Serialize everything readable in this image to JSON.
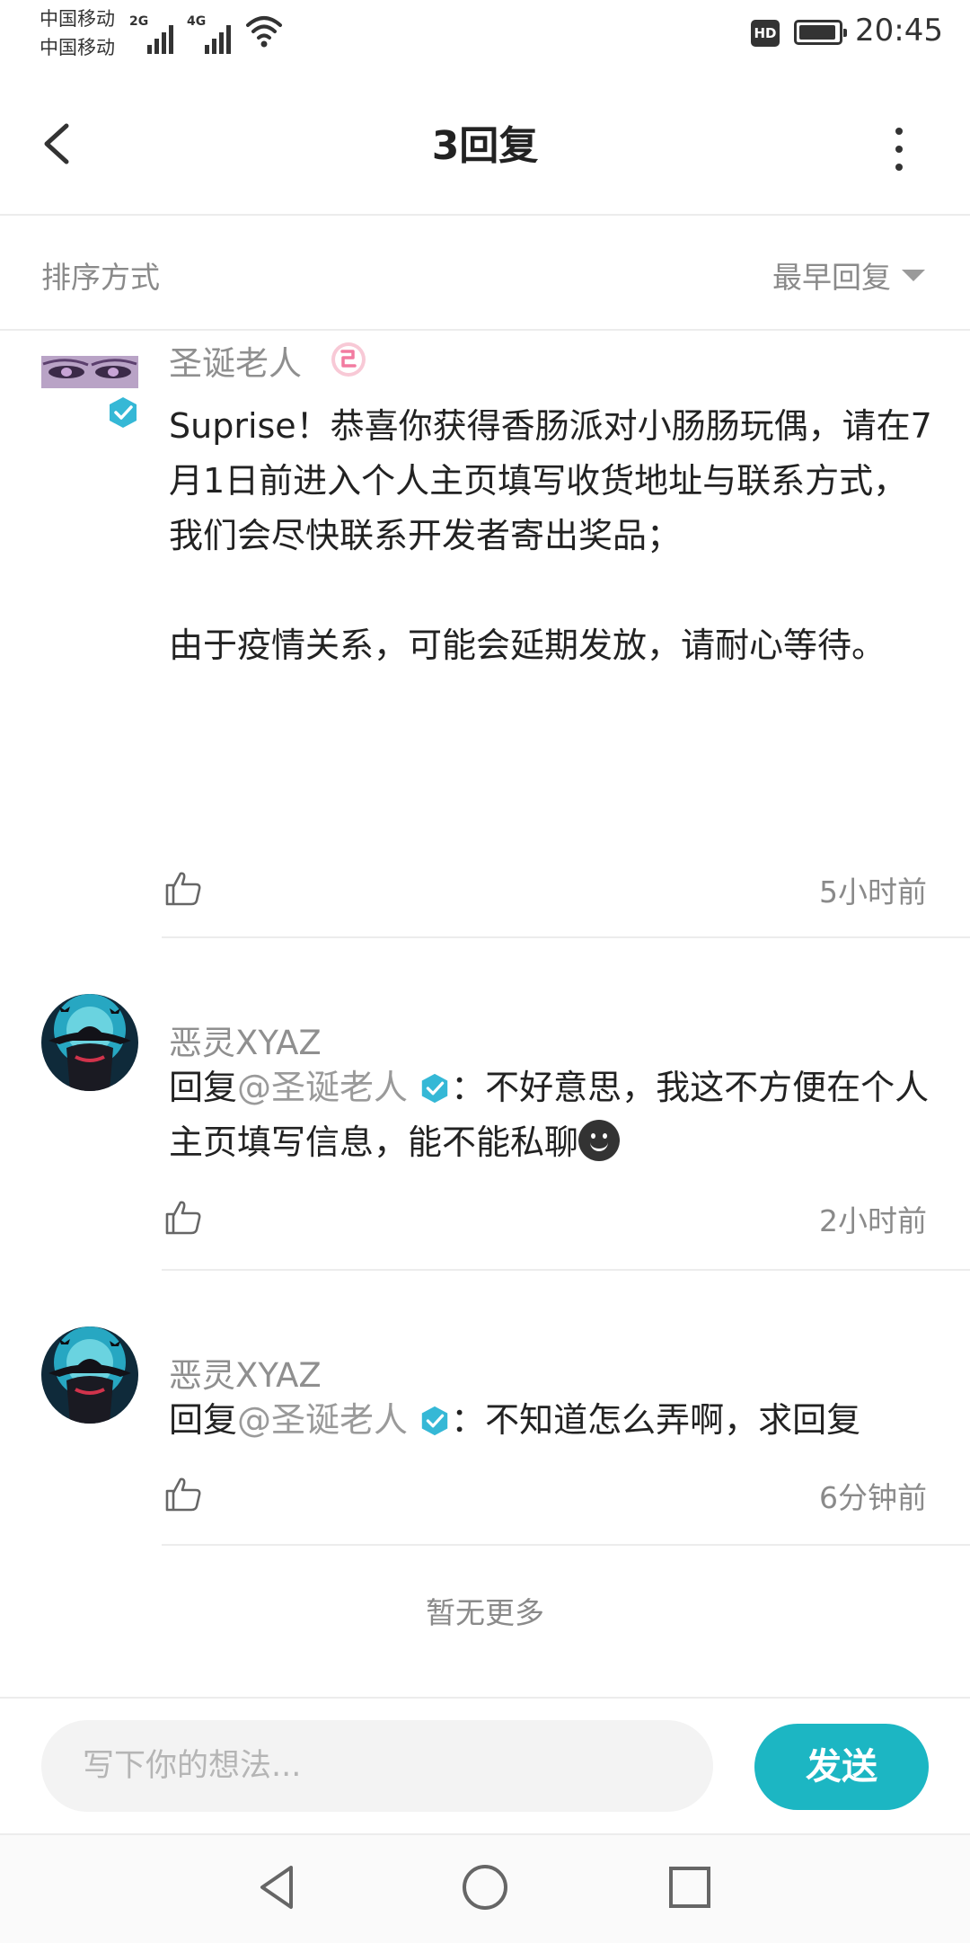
{
  "status_bar": {
    "carrier_1": "中国移动",
    "carrier_2": "中国移动",
    "network_1": "2G",
    "network_2": "4G",
    "hd": "HD",
    "time": "20:45"
  },
  "header": {
    "title": "3回复",
    "back_icon": "chevron-left-icon",
    "more_icon": "more-vertical-icon"
  },
  "sort": {
    "label": "排序方式",
    "value": "最早回复"
  },
  "comments": [
    {
      "user": "圣诞老人",
      "body_line_1": "Suprise！恭喜你获得香肠派对小肠肠玩偶，请在7月1日前进入个人主页填写收货地址与联系方式，我们会尽快联系开发者寄出奖品；",
      "body_line_2": "由于疫情关系，可能会延期发放，请耐心等待。",
      "time": "5小时前"
    },
    {
      "user": "恶灵XYAZ",
      "reply_prefix": "回复",
      "mention": "@圣诞老人",
      "body": "：不好意思，我这不方便在个人主页填写信息，能不能私聊",
      "time": "2小时前"
    },
    {
      "user": "恶灵XYAZ",
      "reply_prefix": "回复",
      "mention": "@圣诞老人",
      "body": "：不知道怎么弄啊，求回复",
      "time": "6分钟前"
    }
  ],
  "no_more": "暂无更多",
  "composer": {
    "placeholder": "写下你的想法...",
    "send_label": "发送"
  },
  "colors": {
    "accent": "#1cb6c3",
    "verified": "#35b8d6",
    "muted_text": "#8a8a8a"
  }
}
